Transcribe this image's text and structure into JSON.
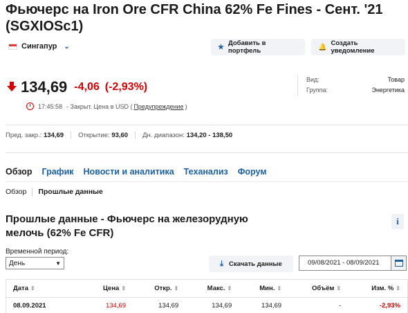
{
  "page": {
    "title": "Фьючерс на Iron Ore CFR China 62% Fe Fines - Сент. '21 (SGXIOSc1)"
  },
  "exchange": {
    "name": "Сингапур",
    "chevron_icon": "chevron-down-icon"
  },
  "actions": {
    "portfolio_label": "Добавить в портфель",
    "alert_label": "Создать уведомление"
  },
  "quote": {
    "price": "134,69",
    "change": "-4,06",
    "change_pct": "(-2,93%)",
    "time": "17:45:58",
    "status_text": "- Закрыт. Цена в USD (",
    "disclaimer_link": "Предупреждение",
    "status_end": ")",
    "direction_color": "#d60000"
  },
  "info": {
    "type_label": "Вид:",
    "type_value": "Товар",
    "group_label": "Группа:",
    "group_value": "Энергетика"
  },
  "stats": {
    "prev_close_label": "Пред. закр.:",
    "prev_close_value": "134,69",
    "open_label": "Открытие:",
    "open_value": "93,60",
    "day_range_label": "Дн. диапазон:",
    "day_range_value": "134,20 - 138,50"
  },
  "tabs": [
    "Обзор",
    "График",
    "Новости и аналитика",
    "Теханализ",
    "Форум"
  ],
  "subtabs": [
    "Обзор",
    "Прошлые данные"
  ],
  "history": {
    "heading": "Прошлые данные - Фьючерс на железорудную мелочь (62% Fe CFR)",
    "period_label": "Временной период:",
    "period_value": "День",
    "download_label": "Скачать данные",
    "date_range": "09/08/2021 - 08/09/2021",
    "columns": [
      "Дата",
      "Цена",
      "Откр.",
      "Макс.",
      "Мин.",
      "Объём",
      "Изм. %"
    ],
    "rows": [
      {
        "date": "08.09.2021",
        "price": "134,69",
        "open": "134,69",
        "high": "134,69",
        "low": "134,69",
        "volume": "-",
        "change": "-2,93%"
      }
    ]
  }
}
